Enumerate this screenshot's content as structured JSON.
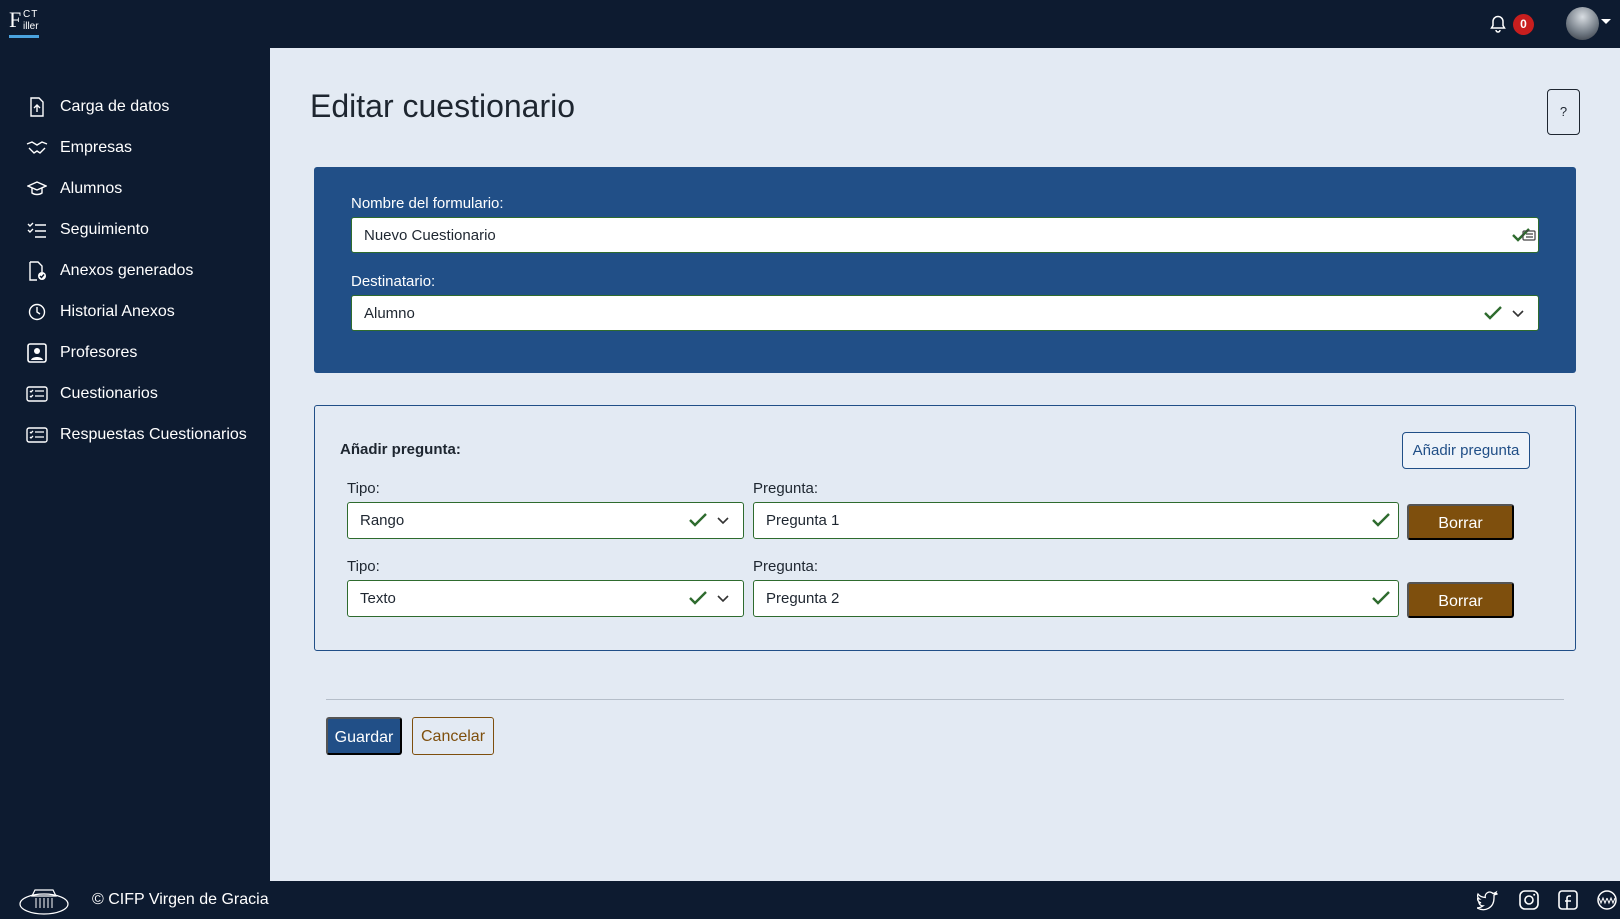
{
  "app": {
    "logo_text_big": "F",
    "logo_text_ct": "CT",
    "logo_text_iller": "iller",
    "notifications_count": "0"
  },
  "sidebar": {
    "items": [
      {
        "label": "Carga de datos",
        "icon": "file-upload-icon"
      },
      {
        "label": "Empresas",
        "icon": "handshake-icon"
      },
      {
        "label": "Alumnos",
        "icon": "graduation-cap-icon"
      },
      {
        "label": "Seguimiento",
        "icon": "checklist-icon"
      },
      {
        "label": "Anexos generados",
        "icon": "file-check-icon"
      },
      {
        "label": "Historial Anexos",
        "icon": "clock-icon"
      },
      {
        "label": "Profesores",
        "icon": "person-board-icon"
      },
      {
        "label": "Cuestionarios",
        "icon": "card-list-icon"
      },
      {
        "label": "Respuestas Cuestionarios",
        "icon": "card-list-icon"
      }
    ]
  },
  "main": {
    "title": "Editar cuestionario",
    "help_label": "?",
    "form": {
      "name_label": "Nombre del formulario:",
      "name_value": "Nuevo Cuestionario",
      "recipient_label": "Destinatario:",
      "recipient_value": "Alumno"
    },
    "questions": {
      "heading": "Añadir pregunta:",
      "add_button": "Añadir pregunta",
      "type_label": "Tipo:",
      "question_label": "Pregunta:",
      "delete_label": "Borrar",
      "rows": [
        {
          "type": "Rango",
          "question": "Pregunta 1"
        },
        {
          "type": "Texto",
          "question": "Pregunta 2"
        }
      ]
    },
    "actions": {
      "save": "Guardar",
      "cancel": "Cancelar"
    }
  },
  "footer": {
    "copyright": "© CIFP Virgen de Gracia",
    "social": [
      "twitter-icon",
      "instagram-icon",
      "facebook-icon",
      "www-icon"
    ]
  },
  "colors": {
    "nav_bg": "#0d1b30",
    "page_bg": "#e3eaf3",
    "primary": "#214f87",
    "danger_brown": "#7e4f0d",
    "valid_green": "#2e6b2e",
    "badge_red": "#c81e1e"
  }
}
